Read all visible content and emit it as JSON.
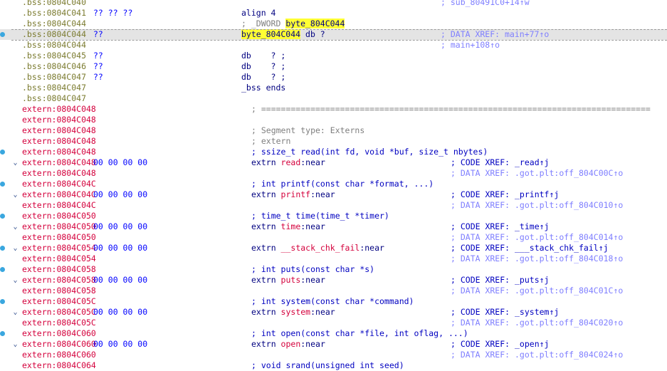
{
  "lines": [
    {
      "addr": ".bss:0804C040",
      "seg": "bss",
      "bytes": "",
      "code": "",
      "comment": "; sub_80491C0+14↑w",
      "comment_kind": "xref"
    },
    {
      "addr": ".bss:0804C041",
      "seg": "bss",
      "bytes": "?? ?? ??",
      "code": "align 4",
      "comment": ""
    },
    {
      "addr": ".bss:0804C044",
      "seg": "bss",
      "bytes": "",
      "code_pre": "; _DWORD ",
      "code_hl": "byte_804C044",
      "code": "",
      "comment": ""
    },
    {
      "addr": ".bss:0804C044",
      "seg": "bss",
      "bytes": "??",
      "code_hl2": "byte_804C044",
      "code": " db ?",
      "comment": "; DATA XREF: main+77↑o",
      "comment_kind": "xref",
      "current": true,
      "dot": true
    },
    {
      "addr": ".bss:0804C044",
      "seg": "bss",
      "bytes": "",
      "code": "",
      "comment": "; main+108↑o",
      "comment_kind": "xref"
    },
    {
      "addr": ".bss:0804C045",
      "seg": "bss",
      "bytes": "??",
      "code": "db    ? ;",
      "comment": ""
    },
    {
      "addr": ".bss:0804C046",
      "seg": "bss",
      "bytes": "??",
      "code": "db    ? ;",
      "comment": ""
    },
    {
      "addr": ".bss:0804C047",
      "seg": "bss",
      "bytes": "??",
      "code": "db    ? ;",
      "comment": ""
    },
    {
      "addr": ".bss:0804C047",
      "seg": "bss",
      "bytes": "",
      "code": "_bss ends",
      "comment": ""
    },
    {
      "addr": ".bss:0804C047",
      "seg": "bss",
      "bytes": "",
      "code": "",
      "comment": ""
    },
    {
      "addr": "extern:0804C048",
      "seg": "extern",
      "bytes": "",
      "ccode": "; ===============================================================================",
      "comment": ""
    },
    {
      "addr": "extern:0804C048",
      "seg": "extern",
      "bytes": "",
      "code": "",
      "comment": ""
    },
    {
      "addr": "extern:0804C048",
      "seg": "extern",
      "bytes": "",
      "ccode": "; Segment type: Externs",
      "comment": ""
    },
    {
      "addr": "extern:0804C048",
      "seg": "extern",
      "bytes": "",
      "ccode": "; extern",
      "comment": ""
    },
    {
      "addr": "extern:0804C048",
      "seg": "extern",
      "bytes": "",
      "bcode": "; ssize_t read(int fd, void *buf, size_t nbytes)",
      "comment": "",
      "dot": true
    },
    {
      "addr": "extern:0804C048",
      "seg": "extern",
      "bytes": "00 00 00 00",
      "ext": "read",
      "comment": "; CODE XREF: _read↑j",
      "comment_kind": "codexref",
      "fold": true
    },
    {
      "addr": "extern:0804C048",
      "seg": "extern",
      "bytes": "",
      "code": "",
      "comment": "; DATA XREF: .got.plt:off_804C00C↑o",
      "comment_kind": "xref"
    },
    {
      "addr": "extern:0804C04C",
      "seg": "extern",
      "bytes": "",
      "bcode": "; int printf(const char *format, ...)",
      "comment": "",
      "dot": true
    },
    {
      "addr": "extern:0804C04C",
      "seg": "extern",
      "bytes": "00 00 00 00",
      "ext": "printf",
      "comment": "; CODE XREF: _printf↑j",
      "comment_kind": "codexref",
      "fold": true
    },
    {
      "addr": "extern:0804C04C",
      "seg": "extern",
      "bytes": "",
      "code": "",
      "comment": "; DATA XREF: .got.plt:off_804C010↑o",
      "comment_kind": "xref"
    },
    {
      "addr": "extern:0804C050",
      "seg": "extern",
      "bytes": "",
      "bcode": "; time_t time(time_t *timer)",
      "comment": "",
      "dot": true
    },
    {
      "addr": "extern:0804C050",
      "seg": "extern",
      "bytes": "00 00 00 00",
      "ext": "time",
      "comment": "; CODE XREF: _time↑j",
      "comment_kind": "codexref",
      "fold": true
    },
    {
      "addr": "extern:0804C050",
      "seg": "extern",
      "bytes": "",
      "code": "",
      "comment": "; DATA XREF: .got.plt:off_804C014↑o",
      "comment_kind": "xref"
    },
    {
      "addr": "extern:0804C054",
      "seg": "extern",
      "bytes": "00 00 00 00",
      "ext": "__stack_chk_fail",
      "comment": "; CODE XREF: ___stack_chk_fail↑j",
      "comment_kind": "codexref",
      "fold": true,
      "dot": true
    },
    {
      "addr": "extern:0804C054",
      "seg": "extern",
      "bytes": "",
      "code": "",
      "comment": "; DATA XREF: .got.plt:off_804C018↑o",
      "comment_kind": "xref"
    },
    {
      "addr": "extern:0804C058",
      "seg": "extern",
      "bytes": "",
      "bcode": "; int puts(const char *s)",
      "comment": "",
      "dot": true
    },
    {
      "addr": "extern:0804C058",
      "seg": "extern",
      "bytes": "00 00 00 00",
      "ext": "puts",
      "comment": "; CODE XREF: _puts↑j",
      "comment_kind": "codexref",
      "fold": true
    },
    {
      "addr": "extern:0804C058",
      "seg": "extern",
      "bytes": "",
      "code": "",
      "comment": "; DATA XREF: .got.plt:off_804C01C↑o",
      "comment_kind": "xref"
    },
    {
      "addr": "extern:0804C05C",
      "seg": "extern",
      "bytes": "",
      "bcode": "; int system(const char *command)",
      "comment": "",
      "dot": true
    },
    {
      "addr": "extern:0804C05C",
      "seg": "extern",
      "bytes": "00 00 00 00",
      "ext": "system",
      "comment": "; CODE XREF: _system↑j",
      "comment_kind": "codexref",
      "fold": true
    },
    {
      "addr": "extern:0804C05C",
      "seg": "extern",
      "bytes": "",
      "code": "",
      "comment": "; DATA XREF: .got.plt:off_804C020↑o",
      "comment_kind": "xref"
    },
    {
      "addr": "extern:0804C060",
      "seg": "extern",
      "bytes": "",
      "bcode": "; int open(const char *file, int oflag, ...)",
      "comment": "",
      "dot": true
    },
    {
      "addr": "extern:0804C060",
      "seg": "extern",
      "bytes": "00 00 00 00",
      "ext": "open",
      "comment": "; CODE XREF: _open↑j",
      "comment_kind": "codexref",
      "fold": true
    },
    {
      "addr": "extern:0804C060",
      "seg": "extern",
      "bytes": "",
      "code": "",
      "comment": "; DATA XREF: .got.plt:off_804C024↑o",
      "comment_kind": "xref"
    },
    {
      "addr": "extern:0804C064",
      "seg": "extern",
      "bytes": "",
      "bcode": "; void srand(unsigned int seed)",
      "comment": ""
    }
  ],
  "colors": {
    "bss_addr": "#7b7b2f",
    "extern_addr": "#d4003c",
    "bytes": "#0000ff",
    "highlight": "#ffff33",
    "current_line": "#e4e4e4",
    "left_dot": "#3aa7df"
  },
  "icons": {
    "fold": "chevron-down-icon",
    "dot": "breakpoint-dot-icon"
  }
}
